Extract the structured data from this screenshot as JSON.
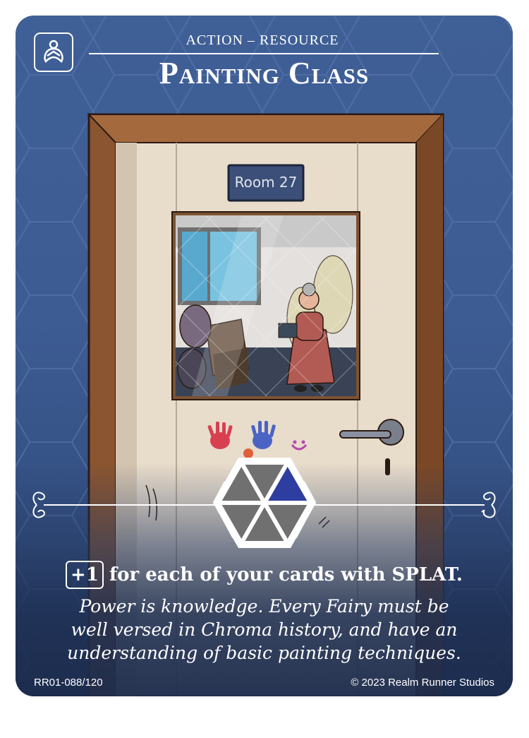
{
  "card": {
    "type_line": "ACTION – RESOURCE",
    "title": "Painting Class",
    "room_sign": "Room 27",
    "ability_cost": "+1",
    "ability_text": "for each of your cards with SPLAT.",
    "flavor_line1": "Power is knowledge. Every Fairy must be",
    "flavor_line2": "well versed in Chroma history, and have an",
    "flavor_line3": "understanding of basic painting techniques.",
    "set_number": "RR01-088/120",
    "copyright": "© 2023 Realm Runner Studios"
  },
  "icons": {
    "faction": "bee-fairy-icon",
    "cost_hex": "hexagon-cost-icon"
  },
  "colors": {
    "background": "#3f5f97",
    "frame_wood": "#8a5530",
    "door": "#e8dccb",
    "hex_highlight": "#2e3ea0",
    "hex_segment": "#707070"
  }
}
